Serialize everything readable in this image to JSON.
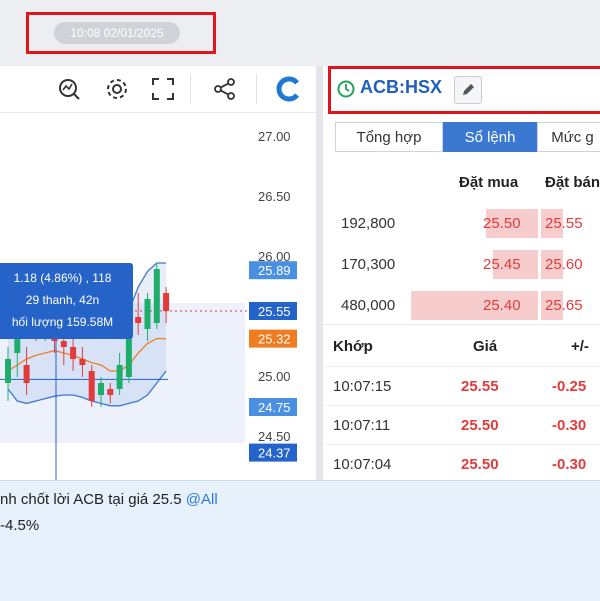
{
  "header": {
    "datetime": "10:08 02/01/2025"
  },
  "chart": {
    "toolbar": {
      "icons": [
        "indicator-icon",
        "gear-icon",
        "fullscreen-icon",
        "share-icon",
        "brand-logo-icon"
      ]
    },
    "tooltip": {
      "line1": "1.18 (4.86%) , 118",
      "line2": "29 thanh, 42n",
      "line3": "hối lượng 159.58M"
    },
    "price_ticks": [
      "27.00",
      "26.50",
      "26.00",
      "25.00",
      "24.50"
    ],
    "price_badges": [
      {
        "label": "25.89",
        "color": "#4a90e2"
      },
      {
        "label": "25.55",
        "color": "#2463c9"
      },
      {
        "label": "25.32",
        "color": "#f07c22"
      },
      {
        "label": "24.75",
        "color": "#4a90e2"
      },
      {
        "label": "24.37",
        "color": "#2463c9"
      }
    ]
  },
  "chart_data": {
    "type": "candlestick",
    "title": "",
    "ylim": [
      24.3,
      27.2
    ],
    "candles": [
      {
        "o": 24.95,
        "h": 25.25,
        "l": 24.8,
        "c": 25.15
      },
      {
        "o": 25.2,
        "h": 25.7,
        "l": 25.0,
        "c": 25.6
      },
      {
        "o": 25.1,
        "h": 25.25,
        "l": 24.85,
        "c": 24.95
      },
      {
        "o": 25.5,
        "h": 25.7,
        "l": 25.3,
        "c": 25.45
      },
      {
        "o": 25.4,
        "h": 25.62,
        "l": 25.3,
        "c": 25.45
      },
      {
        "o": 25.55,
        "h": 25.6,
        "l": 25.2,
        "c": 25.3
      },
      {
        "o": 25.3,
        "h": 25.4,
        "l": 25.1,
        "c": 25.25
      },
      {
        "o": 25.25,
        "h": 25.35,
        "l": 25.05,
        "c": 25.15
      },
      {
        "o": 25.15,
        "h": 25.25,
        "l": 25.0,
        "c": 25.1
      },
      {
        "o": 25.05,
        "h": 25.1,
        "l": 24.75,
        "c": 24.8
      },
      {
        "o": 24.85,
        "h": 25.0,
        "l": 24.75,
        "c": 24.95
      },
      {
        "o": 24.9,
        "h": 24.95,
        "l": 24.78,
        "c": 24.85
      },
      {
        "o": 24.9,
        "h": 25.2,
        "l": 24.85,
        "c": 25.1
      },
      {
        "o": 25.0,
        "h": 25.6,
        "l": 24.95,
        "c": 25.55
      },
      {
        "o": 25.5,
        "h": 25.7,
        "l": 25.35,
        "c": 25.45
      },
      {
        "o": 25.4,
        "h": 25.7,
        "l": 25.3,
        "c": 25.65
      },
      {
        "o": 25.45,
        "h": 25.95,
        "l": 25.4,
        "c": 25.9
      },
      {
        "o": 25.7,
        "h": 25.75,
        "l": 25.45,
        "c": 25.55
      }
    ],
    "upper_band": [
      25.4,
      25.6,
      25.7,
      25.72,
      25.68,
      25.6,
      25.55,
      25.5,
      25.48,
      25.45,
      25.42,
      25.4,
      25.45,
      25.55,
      25.75,
      25.88,
      25.95,
      25.95
    ],
    "lower_band": [
      24.9,
      24.8,
      24.78,
      24.8,
      24.82,
      24.84,
      24.85,
      24.85,
      24.83,
      24.8,
      24.78,
      24.76,
      24.76,
      24.78,
      24.8,
      24.85,
      24.95,
      25.05
    ],
    "ma_line": [
      25.05,
      25.1,
      25.15,
      25.18,
      25.2,
      25.22,
      25.2,
      25.18,
      25.15,
      25.12,
      25.1,
      25.05,
      25.05,
      25.1,
      25.2,
      25.28,
      25.32,
      25.32
    ],
    "last_price": 25.55
  },
  "order_panel": {
    "symbol": "ACB:HSX",
    "tabs": [
      "Tổng hợp",
      "Sổ lệnh",
      "Mức g"
    ],
    "active_tab": 1,
    "orderbook_headers": {
      "bid": "Đặt mua",
      "ask": "Đặt bán"
    },
    "orderbook": [
      {
        "vol": "192,800",
        "bid": "25.50",
        "ask": "25.55",
        "bid_share": 0.24
      },
      {
        "vol": "170,300",
        "bid": "25.45",
        "ask": "25.60",
        "bid_share": 0.21
      },
      {
        "vol": "480,000",
        "bid": "25.40",
        "ask": "25.65",
        "bid_share": 0.59
      }
    ],
    "match_headers": {
      "time": "Khớp",
      "price": "Giá",
      "change": "+/-"
    },
    "matches": [
      {
        "time": "10:07:15",
        "price": "25.55",
        "change": "-0.25"
      },
      {
        "time": "10:07:11",
        "price": "25.50",
        "change": "-0.30"
      },
      {
        "time": "10:07:04",
        "price": "25.50",
        "change": "-0.30"
      }
    ]
  },
  "chat": {
    "line1_text": "nh chốt lời ACB tại giá 25.5 ",
    "line1_mention": "@All",
    "line2_text": "-4.5%"
  }
}
